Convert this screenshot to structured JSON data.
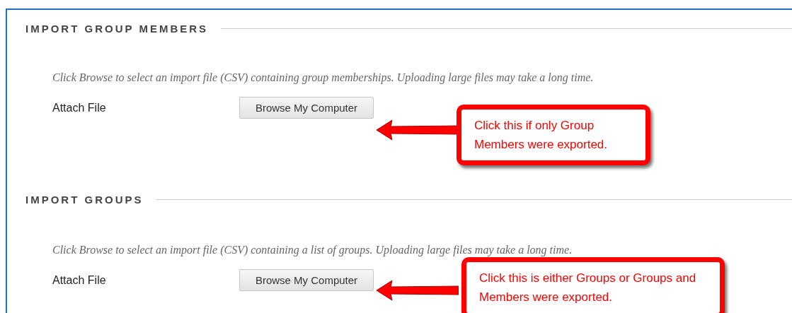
{
  "sections": [
    {
      "heading": "IMPORT GROUP MEMBERS",
      "description": "Click Browse to select an import file (CSV) containing group memberships. Uploading large files may take a long time.",
      "field_label": "Attach File",
      "button": "Browse My Computer",
      "callout": "Click this if only Group Members were exported."
    },
    {
      "heading": "IMPORT GROUPS",
      "description": "Click Browse to select an import file (CSV) containing a list of groups. Uploading large files may take a long time.",
      "field_label": "Attach File",
      "button": "Browse My Computer",
      "callout": "Click this is either Groups or Groups and Members were exported."
    }
  ]
}
